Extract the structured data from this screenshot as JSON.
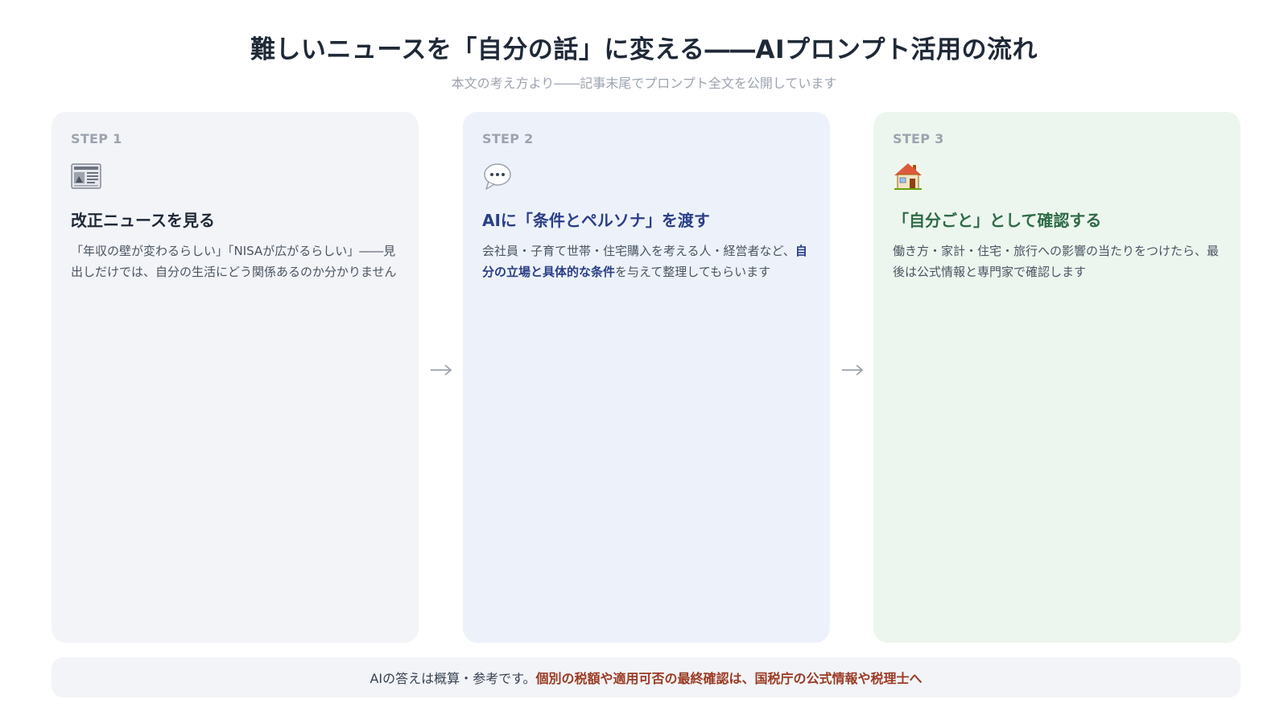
{
  "title": "難しいニュースを「自分の話」に変える――AIプロンプト活用の流れ",
  "subtitle": "本文の考え方より――記事末尾でプロンプト全文を公開しています",
  "steps": [
    {
      "label": "STEP 1",
      "icon": "newspaper-icon",
      "heading": "改正ニュースを見る",
      "body": "「年収の壁が変わるらしい」「NISAが広がるらしい」――見出しだけでは、自分の生活にどう関係あるのか分かりません"
    },
    {
      "label": "STEP 2",
      "icon": "speech-bubble-icon",
      "heading": "AIに「条件とペルソナ」を渡す",
      "body_before": "会社員・子育て世帯・住宅購入を考える人・経営者など、",
      "body_emphasis": "自分の立場と具体的な条件",
      "body_after": "を与えて整理してもらいます"
    },
    {
      "label": "STEP 3",
      "icon": "house-icon",
      "heading": "「自分ごと」として確認する",
      "body": "働き方・家計・住宅・旅行への影響の当たりをつけたら、最後は公式情報と専門家で確認します"
    }
  ],
  "note": {
    "plain": "AIの答えは概算・参考です。",
    "warning": "個別の税額や適用可否の最終確認は、国税庁の公式情報や税理士へ"
  },
  "colors": {
    "card1_bg": "#f3f4f7",
    "card2_bg": "#edf2fa",
    "card3_bg": "#edf6ee",
    "step2_accent": "#2b3f88",
    "step3_accent": "#2e6b47",
    "warning": "#9a3b24"
  }
}
